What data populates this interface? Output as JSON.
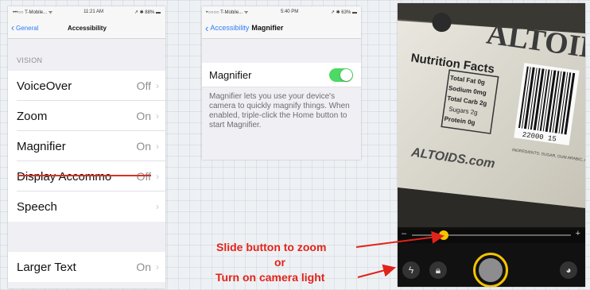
{
  "panel1": {
    "status": {
      "carrier": "•••○○ T-Mobile... ᯤ",
      "time": "11:21 AM",
      "battery": "↗ ✱ 88% ▬"
    },
    "nav": {
      "back_label": "General",
      "title": "Accessibility"
    },
    "section_header": "VISION",
    "rows": [
      {
        "label": "VoiceOver",
        "value": "Off"
      },
      {
        "label": "Zoom",
        "value": "On"
      },
      {
        "label": "Magnifier",
        "value": "On"
      },
      {
        "label": "Display Accommo",
        "value": "Off"
      },
      {
        "label": "Speech",
        "value": ""
      },
      {
        "label": "Larger Text",
        "value": "On"
      }
    ],
    "chevron": "›"
  },
  "panel2": {
    "status": {
      "carrier": "•○○○○ T-Mobile... ᯤ",
      "time": "5:40 PM",
      "battery": "↗ ✱ 63% ▬"
    },
    "nav": {
      "back_label": "Accessibility",
      "title": "Magnifier"
    },
    "toggle_label": "Magnifier",
    "toggle_on": true,
    "description": "Magnifier lets you use your device's camera to quickly magnify things. When enabled, triple-click the Home button to start Magnifier."
  },
  "panel3": {
    "package_text": {
      "brand": "ALTOIDS",
      "nutrition": "Nutrition Facts",
      "website": "ALTOIDS.com",
      "ingredients": "INGREDIENTS: SUGAR, GUM ARABIC, ARTIFICIAL FLAVOR, GELATIN, COLOR (RED 40)",
      "barcode_number": "22000 15",
      "lines": [
        "Total Fat 0g",
        "Sodium 0mg",
        "Total Carb 2g",
        "Sugars 2g",
        "Protein 0g"
      ]
    },
    "zoom_level": 0.2,
    "slider_minus": "–",
    "slider_plus": "+"
  },
  "annotations": {
    "line1": "Slide button to zoom",
    "line2": "or",
    "line3": "Turn on camera light"
  },
  "colors": {
    "accent_blue": "#2d7cf6",
    "toggle_green": "#4cd964",
    "annotation_red": "#e2231a",
    "thumb_yellow": "#f5c400"
  }
}
